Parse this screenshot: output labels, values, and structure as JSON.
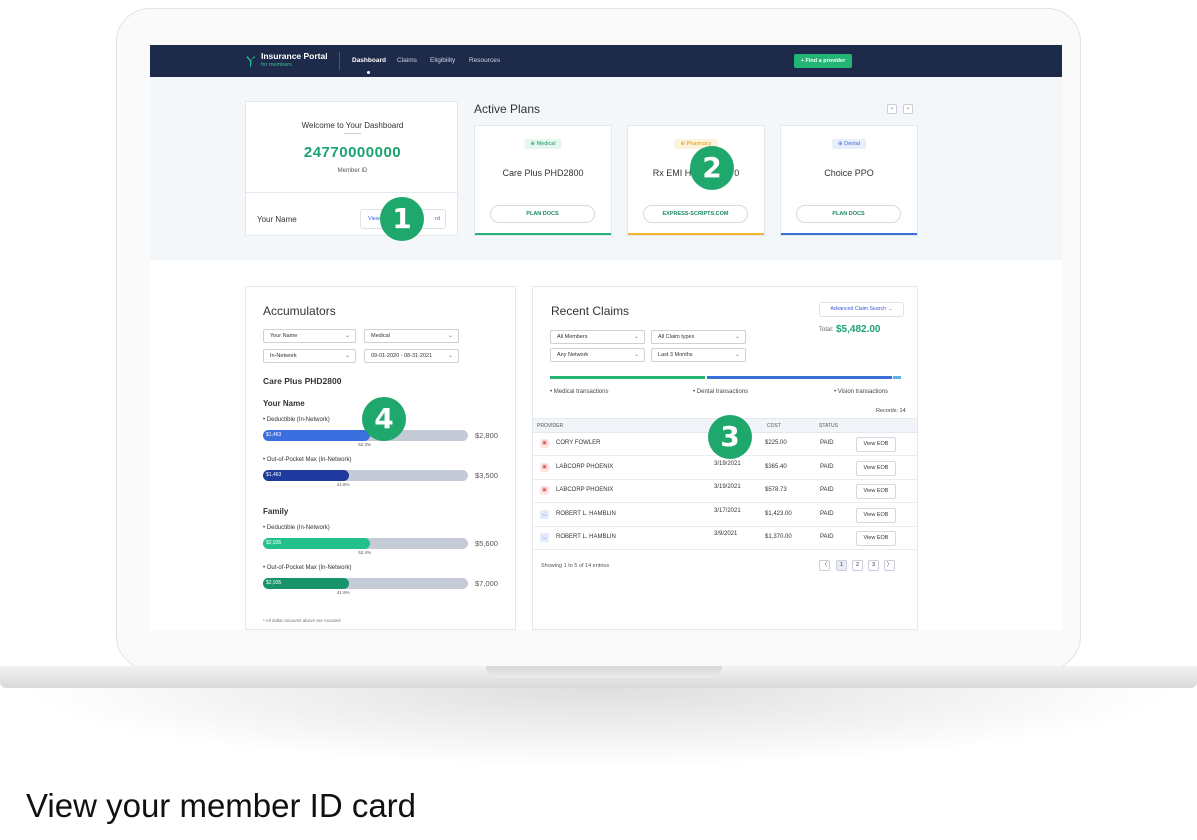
{
  "app": {
    "logo_title": "Insurance Portal",
    "logo_subtitle": "for members",
    "nav": [
      "Dashboard",
      "Claims",
      "Eligibility",
      "Resources"
    ],
    "find_provider": "+ Find a provider"
  },
  "welcome": {
    "title": "Welcome to Your Dashboard",
    "member_id": "24770000000",
    "member_id_label": "Member ID",
    "name": "Your Name",
    "button_left": "View",
    "button_right": "rd"
  },
  "active_plans": {
    "title": "Active Plans",
    "prev": "‹",
    "next": "›",
    "plans": [
      {
        "badge": "⊕ Medical",
        "name": "Care Plus PHD2800",
        "button": "PLAN DOCS",
        "color": "#22b573"
      },
      {
        "badge": "⊕ Pharmacy",
        "name": "Rx EMI He",
        "name_tail": "0",
        "button": "EXPRESS-SCRIPTS.COM",
        "color": "#f2b632"
      },
      {
        "badge": "⊕ Dental",
        "name": "Choice PPO",
        "button": "PLAN DOCS",
        "color": "#3b6fd8"
      }
    ]
  },
  "accumulators": {
    "title": "Accumulators",
    "filters": [
      "Your Name",
      "Medical",
      "In-Network",
      "09-01-2020 - 08-31-2021"
    ],
    "plan": "Care Plus PHD2800",
    "groups": [
      {
        "title": "Your Name",
        "items": [
          {
            "label": "• Deductible (In-Network)",
            "value": "$1,463",
            "percent_label": "52.3%",
            "percent": 52.3,
            "max": "$2,800",
            "color": "#3b6fe0"
          },
          {
            "label": "• Out-of-Pocket Max (In-Network)",
            "value": "$1,463",
            "percent_label": "41.8%",
            "percent": 41.8,
            "max": "$3,500",
            "color": "#1f3a9e"
          }
        ]
      },
      {
        "title": "Family",
        "items": [
          {
            "label": "• Deductible (In-Network)",
            "value": "$2,935",
            "percent_label": "52.4%",
            "percent": 52.4,
            "max": "$5,600",
            "color": "#22c08a"
          },
          {
            "label": "• Out-of-Pocket Max (In-Network)",
            "value": "$2,935",
            "percent_label": "41.9%",
            "percent": 41.9,
            "max": "$7,000",
            "color": "#17946a"
          }
        ]
      }
    ],
    "note": "* All dollar amounts above are rounded"
  },
  "claims": {
    "title": "Recent Claims",
    "advanced_search": "Advanced Claim Search →",
    "total_label": "Total:",
    "total": "$5,482.00",
    "filters": [
      "All Members",
      "All Claim types",
      "Any Network",
      "Last 3 Months"
    ],
    "transactions": [
      "• Medical transactions",
      "• Dental transactions",
      "• Vision transactions"
    ],
    "transaction_colors": [
      "#22b573",
      "#3b6fd8",
      "#5ab0ee"
    ],
    "records": "Records: 14",
    "headers": [
      "PROVIDER",
      "COST",
      "STATUS"
    ],
    "rows": [
      {
        "provider": "CORY FOWLER",
        "date": "",
        "cost": "$225.00",
        "status": "PAID",
        "action": "View EOB",
        "type": "medical"
      },
      {
        "provider": "LABCORP PHOENIX",
        "date": "3/19/2021",
        "cost": "$365.40",
        "status": "PAID",
        "action": "View EOB",
        "type": "medical"
      },
      {
        "provider": "LABCORP PHOENIX",
        "date": "3/19/2021",
        "cost": "$578.73",
        "status": "PAID",
        "action": "View EOB",
        "type": "medical"
      },
      {
        "provider": "ROBERT L. HAMBLIN",
        "date": "3/17/2021",
        "cost": "$1,423.00",
        "status": "PAID",
        "action": "View EOB",
        "type": "dental"
      },
      {
        "provider": "ROBERT L. HAMBLIN",
        "date": "3/9/2021",
        "cost": "$1,370.00",
        "status": "PAID",
        "action": "View EOB",
        "type": "dental"
      }
    ],
    "showing": "Showing 1 to 5 of 14 entries",
    "pagination": [
      "〈",
      "1",
      "2",
      "3",
      "〉"
    ]
  },
  "steps": [
    "1",
    "2",
    "3",
    "4"
  ],
  "caption": "View your member ID card"
}
